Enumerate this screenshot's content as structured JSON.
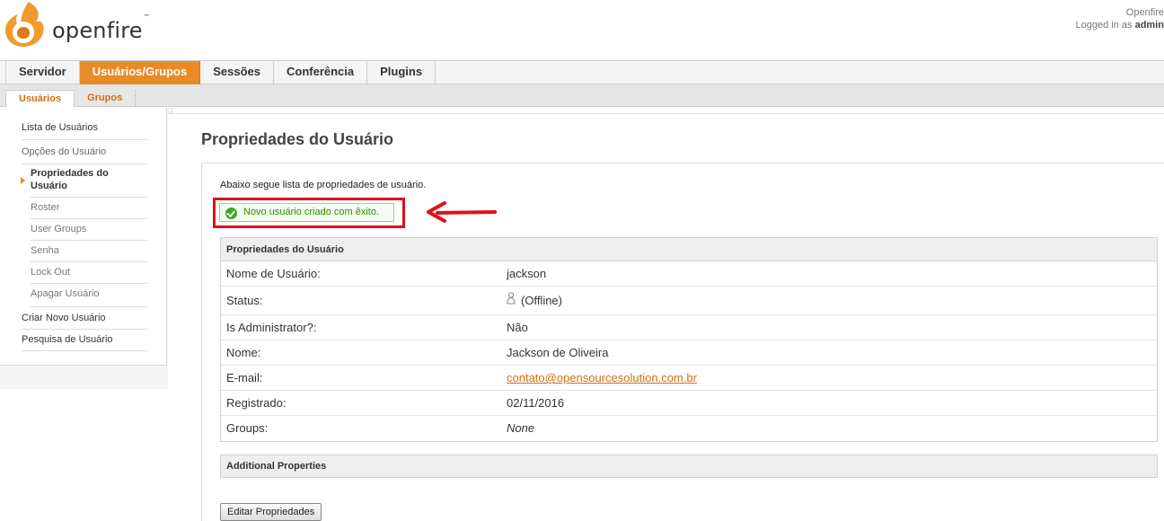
{
  "header": {
    "logo_text": "openfire",
    "logo_tm": "™",
    "app_name": "Openfire",
    "logged_in_prefix": "Logged in as ",
    "logged_in_user": "admin"
  },
  "main_nav": {
    "items": [
      "Servidor",
      "Usuários/Grupos",
      "Sessões",
      "Conferência",
      "Plugins"
    ],
    "active": "Usuários/Grupos"
  },
  "sub_nav": {
    "items": [
      "Usuários",
      "Grupos"
    ],
    "active": "Usuários"
  },
  "sidebar": {
    "list_users": "Lista de Usuários",
    "user_options": "Opções do Usuário",
    "properties": "Propriedades do Usuário",
    "roster": "Roster",
    "user_groups": "User Groups",
    "password": "Senha",
    "lock_out": "Lock Out",
    "delete_user": "Apagar Usuário",
    "create_user": "Criar Novo Usuário",
    "search_user": "Pesquisa de Usuário"
  },
  "main": {
    "title": "Propriedades do Usuário",
    "intro": "Abaixo segue lista de propriedades de usuário.",
    "success_message": "Novo usuário criado com êxito.",
    "table_header": "Propriedades do Usuário",
    "rows": [
      {
        "label": "Nome de Usuário:",
        "value": "jackson"
      },
      {
        "label": "Status:",
        "value": "(Offline)"
      },
      {
        "label": "Is Administrator?:",
        "value": "Não"
      },
      {
        "label": "Nome:",
        "value": "Jackson de Oliveira"
      },
      {
        "label": "E-mail:",
        "value": "contato@opensourcesolution.com.br"
      },
      {
        "label": "Registrado:",
        "value": "02/11/2016"
      },
      {
        "label": "Groups:",
        "value": "None"
      }
    ],
    "additional_header": "Additional Properties",
    "edit_button": "Editar Propriedades"
  },
  "colors": {
    "accent": "#e98b27",
    "link": "#d06f12",
    "success": "#2f8d00",
    "annotation": "#e0101a"
  }
}
